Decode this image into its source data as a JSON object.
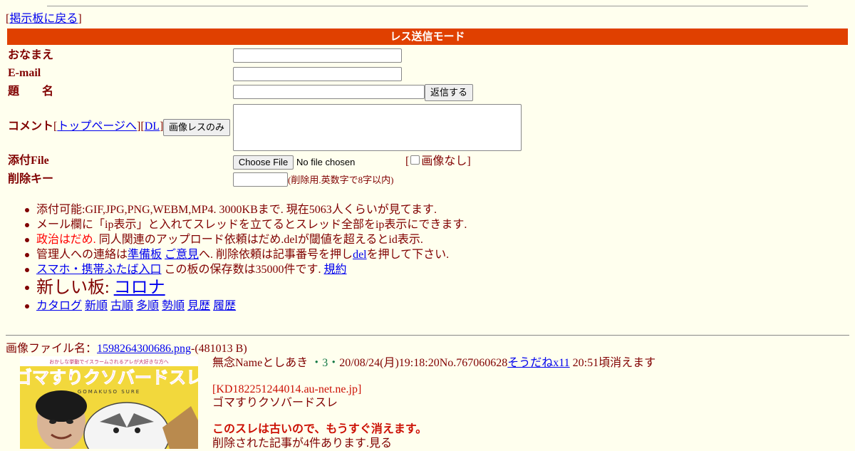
{
  "nav": {
    "back_prefix": "[",
    "back_link": "掲示板に戻る",
    "back_suffix": "]"
  },
  "mode_title": "レス送信モード",
  "form": {
    "name_label": "おなまえ",
    "email_label": "E-mail",
    "subject_label": "題　　名",
    "submit_label": "返信する",
    "comment_label": "コメント",
    "comment_links": [
      "トップページへ",
      "DL"
    ],
    "image_only_label": "画像レスのみ",
    "file_label": "添付File",
    "choose_file_label": "Choose File",
    "no_file_text": "No file chosen",
    "no_image_label": "画像なし",
    "delete_key_label": "削除キー",
    "delete_key_hint": "(削除用.英数字で8字以内)"
  },
  "rules": {
    "line1": "添付可能:GIF,JPG,PNG,WEBM,MP4. 3000KBまで. 現在5063人くらいが見てます.",
    "line2": "メール欄に「ip表示」と入れてスレッドを立てるとスレッド全部をip表示にできます.",
    "line3_red": "政治はだめ.",
    "line3_rest": " 同人関連のアップロード依頼はだめ.delが閾値を超えるとid表示.",
    "line4_a": "管理人への連絡は",
    "line4_link1": "準備板",
    "line4_link2": "ご意見",
    "line4_b": "へ. 削除依頼は記事番号を押し",
    "line4_link3": "del",
    "line4_c": "を押して下さい.",
    "line5_link": "スマホ・携帯ふたば入口",
    "line5_text": " この板の保存数は35000件です. ",
    "line5_link2": "規約",
    "new_board_text": "新しい板: ",
    "new_board_link": "コロナ",
    "sort_links": [
      "カタログ",
      "新順",
      "古順",
      "多順",
      "勢順",
      "見歴",
      "履歴"
    ]
  },
  "post": {
    "file_label": "画像ファイル名：",
    "file_name": "1598264300686.png",
    "file_size": "-(481013 B)",
    "thumb_title": "ゴマすりクソバードスレ",
    "thumb_small_text": "おかしな挙動でイスラームされるアレが大好きな方へ",
    "thumb_sub": "GOMAKUSO SURE",
    "author": "無念Nameとしあき",
    "dot": "・",
    "count": "3",
    "datetime": "20/08/24(月)19:18:20No.767060628",
    "soudane": "そうだねx11",
    "expire": " 20:51頃消えます",
    "ip": "[KD182251244014.au-net.ne.jp]",
    "body": "ゴマすりクソバードスレ",
    "warning": "このスレは古いので、もうすぐ消えます。",
    "deleted_info": "削除された記事が4件あります.見る"
  },
  "colors": {
    "accent_bar": "#e04000",
    "background": "#ffffee",
    "text": "#800000"
  }
}
